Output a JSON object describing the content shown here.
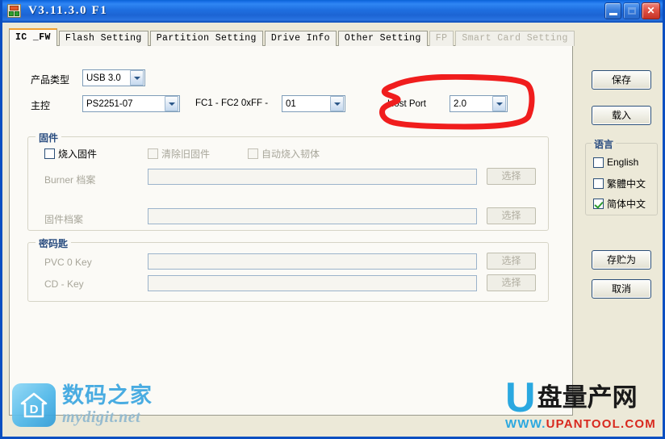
{
  "window": {
    "title": "V3.11.3.0 F1",
    "icon": "app-icon",
    "buttons": {
      "minimize": "minimize-button",
      "maximize": "maximize-button",
      "close": "close-button",
      "close_glyph": "✕"
    }
  },
  "tabs": [
    {
      "label": "IC _FW",
      "active": true,
      "enabled": true
    },
    {
      "label": "Flash Setting",
      "active": false,
      "enabled": true
    },
    {
      "label": "Partition Setting",
      "active": false,
      "enabled": true
    },
    {
      "label": "Drive Info",
      "active": false,
      "enabled": true
    },
    {
      "label": "Other Setting",
      "active": false,
      "enabled": true
    },
    {
      "label": "FP",
      "active": false,
      "enabled": false
    },
    {
      "label": "Smart Card Setting",
      "active": false,
      "enabled": false
    }
  ],
  "form": {
    "product_type_label": "产品类型",
    "product_type_value": "USB 3.0",
    "controller_label": "主控",
    "controller_value": "PS2251-07",
    "fc_label": "FC1 - FC2   0xFF -",
    "fc_value": "01",
    "host_port_label": "Host Port",
    "host_port_value": "2.0"
  },
  "firmware_group": {
    "legend": "固件",
    "checkboxes": [
      {
        "label": "烧入固件",
        "checked": false,
        "enabled": true
      },
      {
        "label": "清除旧固件",
        "checked": false,
        "enabled": false
      },
      {
        "label": "自动烧入韧体",
        "checked": false,
        "enabled": false
      }
    ],
    "rows": [
      {
        "label": "Burner 档案",
        "value": "",
        "button": "选择"
      },
      {
        "label": "固件档案",
        "value": "",
        "button": "选择"
      }
    ]
  },
  "password_group": {
    "legend": "密码匙",
    "rows": [
      {
        "label": "PVC 0 Key",
        "value": "",
        "button": "选择"
      },
      {
        "label": "CD - Key",
        "value": "",
        "button": "选择"
      }
    ]
  },
  "side": {
    "save_label": "保存",
    "load_label": "载入",
    "save_as_label": "存贮为",
    "cancel_label": "取消",
    "language_group": {
      "legend": "语言",
      "options": [
        {
          "label": "English",
          "checked": false
        },
        {
          "label": "繁體中文",
          "checked": false
        },
        {
          "label": "简体中文",
          "checked": true
        }
      ]
    }
  },
  "annotation": {
    "shape": "red-hand-drawn-circle",
    "color": "#f01d1d",
    "targets": "host-port-dropdown"
  },
  "watermarks": {
    "left": {
      "cn": "数码之家",
      "en": "mydigit.net",
      "icon": "house-logo-icon"
    },
    "right": {
      "u": "U",
      "cn": "盘量产网",
      "url_www": "WWW.",
      "url_domain": "UPANTOOL",
      "url_tld": ".COM"
    }
  },
  "colors": {
    "titlebar": "#1f6fe0",
    "accent_tab": "#f0a030",
    "annotation_red": "#f01d1d",
    "panel_bg": "#fbfaf6",
    "window_bg": "#ece9d8"
  }
}
